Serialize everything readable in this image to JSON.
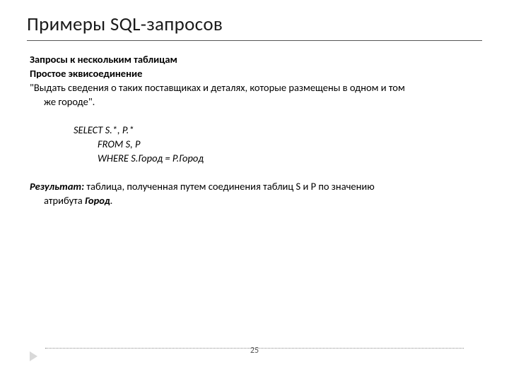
{
  "title": "Примеры SQL-запросов",
  "section": {
    "heading1": "Запросы к нескольким таблицам",
    "heading2": "Простое эквисоединение",
    "promptLine1": "\"Выдать сведения о таких поставщиках и деталях, которые размещены в одном и том",
    "promptLine2": "же городе\"."
  },
  "sql": {
    "line1": "SELECT  S.*,  P.*",
    "line2": "FROM   S, P",
    "line3": "WHERE  S.Город = P.Город"
  },
  "result": {
    "label": "Результат:",
    "text1": " таблица, полученная путем соединения таблиц S и P по значению",
    "text2a": "атрибута ",
    "city": "Город",
    "text2b": "."
  },
  "pageNumber": "25"
}
